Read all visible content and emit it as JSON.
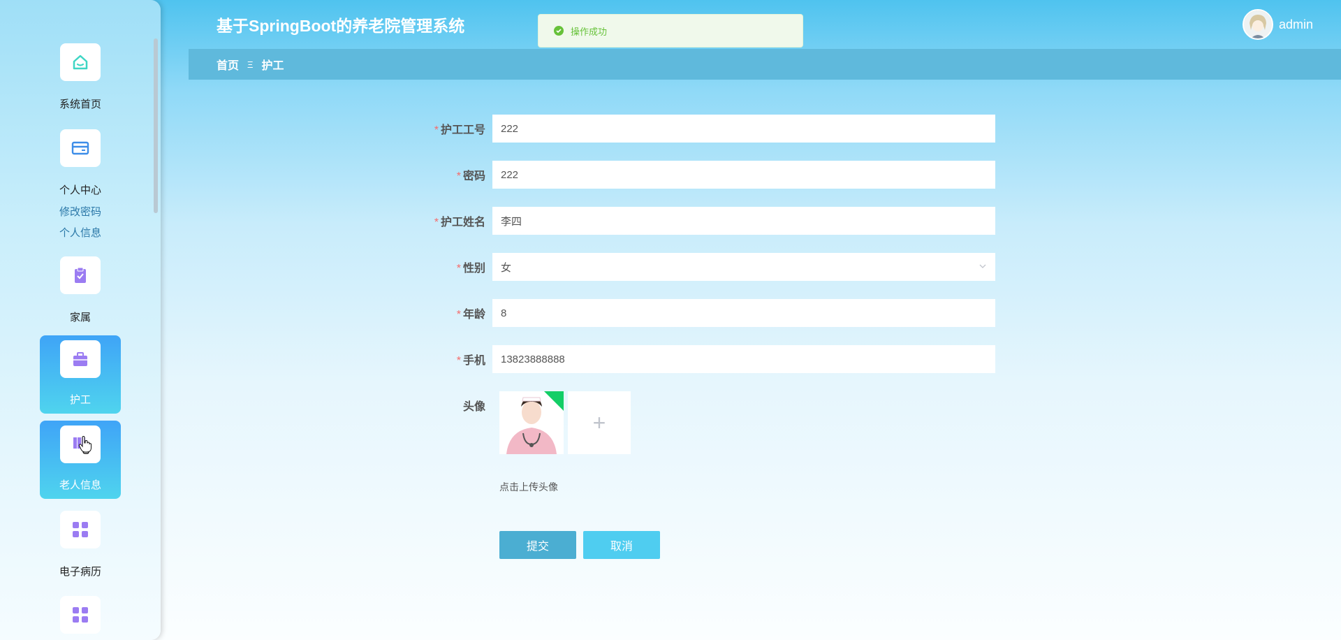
{
  "header": {
    "title": "基于SpringBoot的养老院管理系统",
    "toast": "操作成功",
    "username": "admin"
  },
  "breadcrumb": {
    "home": "首页",
    "separator": "Ξ",
    "current": "护工"
  },
  "sidebar": {
    "items": [
      {
        "label": "系统首页",
        "icon": "home-icon"
      },
      {
        "label": "个人中心",
        "icon": "card-icon"
      },
      {
        "label": "家属",
        "icon": "clipboard-icon"
      },
      {
        "label": "护工",
        "icon": "briefcase-icon",
        "active": true
      },
      {
        "label": "老人信息",
        "icon": "books-icon",
        "active": true
      },
      {
        "label": "电子病历",
        "icon": "grid-icon"
      },
      {
        "label": "",
        "icon": "grid-icon"
      }
    ],
    "submenu": [
      "修改密码",
      "个人信息"
    ]
  },
  "form": {
    "fields": [
      {
        "label": "护工工号",
        "value": "222",
        "required": true
      },
      {
        "label": "密码",
        "value": "222",
        "required": true
      },
      {
        "label": "护工姓名",
        "value": "李四",
        "required": true
      },
      {
        "label": "性别",
        "value": "女",
        "required": true,
        "type": "select"
      },
      {
        "label": "年龄",
        "value": "8",
        "required": true
      },
      {
        "label": "手机",
        "value": "13823888888",
        "required": true
      }
    ],
    "required_mark": "*",
    "avatar_label": "头像",
    "upload_hint": "点击上传头像",
    "add_symbol": "+",
    "submit": "提交",
    "cancel": "取消"
  },
  "colors": {
    "accent": "#4baed2",
    "active_menu_top": "#3fa4f7",
    "active_menu_bottom": "#4fd4ee",
    "success": "#67c23a",
    "required": "#f56c6c"
  }
}
